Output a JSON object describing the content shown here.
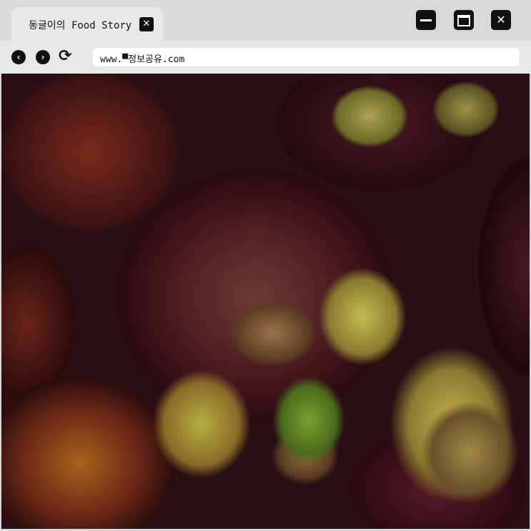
{
  "tab": {
    "title": "동글이의 Food Story",
    "close_icon": "close-icon"
  },
  "window_controls": {
    "minimize": "minimize-icon",
    "maximize": "maximize-icon",
    "close": "close-icon"
  },
  "toolbar": {
    "back_icon": "chevron-left-icon",
    "forward_icon": "chevron-right-icon",
    "reload_icon": "reload-icon",
    "url": "www.▀정보공유.com"
  },
  "colors": {
    "titlebar": "#d9d9d9",
    "toolbar": "#e8e8e8",
    "icon": "#111111"
  }
}
